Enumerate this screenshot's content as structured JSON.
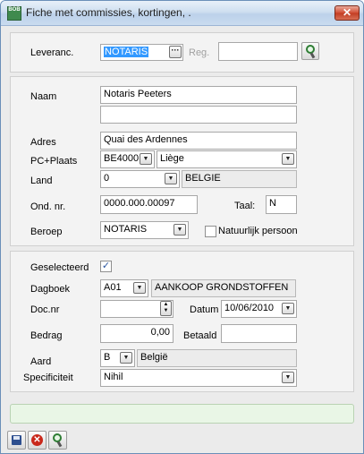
{
  "window": {
    "title": "Fiche met commissies, kortingen, .",
    "app_icon_text": "BOB",
    "close_glyph": "✕"
  },
  "supplier_section": {
    "leveranc_label": "Leveranc.",
    "leveranc_value": "NOTARIS",
    "browse_glyph": "···",
    "reg_label": "Reg.",
    "reg_value": ""
  },
  "address_section": {
    "naam_label": "Naam",
    "naam_value": "Notaris Peeters",
    "naam2_value": "",
    "adres_label": "Adres",
    "adres_value": "Quai des Ardennes",
    "pc_plaats_label": "PC+Plaats",
    "pc_value": "BE4000",
    "plaats_value": "Liège",
    "land_label": "Land",
    "land_code": "0",
    "land_name": "BELGIE",
    "ond_nr_label": "Ond. nr.",
    "ond_nr_value": "0000.000.00097",
    "taal_label": "Taal:",
    "taal_value": "N",
    "beroep_label": "Beroep",
    "beroep_value": "NOTARIS",
    "natuurlijk_label": "Natuurlijk persoon",
    "natuurlijk_checked": false
  },
  "document_section": {
    "geselecteerd_label": "Geselecteerd",
    "geselecteerd_checked": true,
    "checkmark": "✓",
    "dagboek_label": "Dagboek",
    "dagboek_code": "A01",
    "dagboek_name": "AANKOOP GRONDSTOFFEN",
    "docnr_label": "Doc.nr",
    "docnr_value": "",
    "datum_label": "Datum",
    "datum_value": "10/06/2010",
    "bedrag_label": "Bedrag",
    "bedrag_value": "0,00",
    "betaald_label": "Betaald",
    "betaald_value": "",
    "aard_label": "Aard",
    "aard_code": "B",
    "aard_name": "België",
    "specificiteit_label": "Specificiteit",
    "specificiteit_value": "Nihil"
  },
  "glyphs": {
    "dropdown": "▼",
    "spin_up": "▲",
    "spin_down": "▼",
    "cancel": "✕"
  },
  "colors": {
    "title_bar": "#cfdff0",
    "close_button": "#c13c22",
    "selection": "#3399ff",
    "status_strip": "#e9f6e6"
  }
}
